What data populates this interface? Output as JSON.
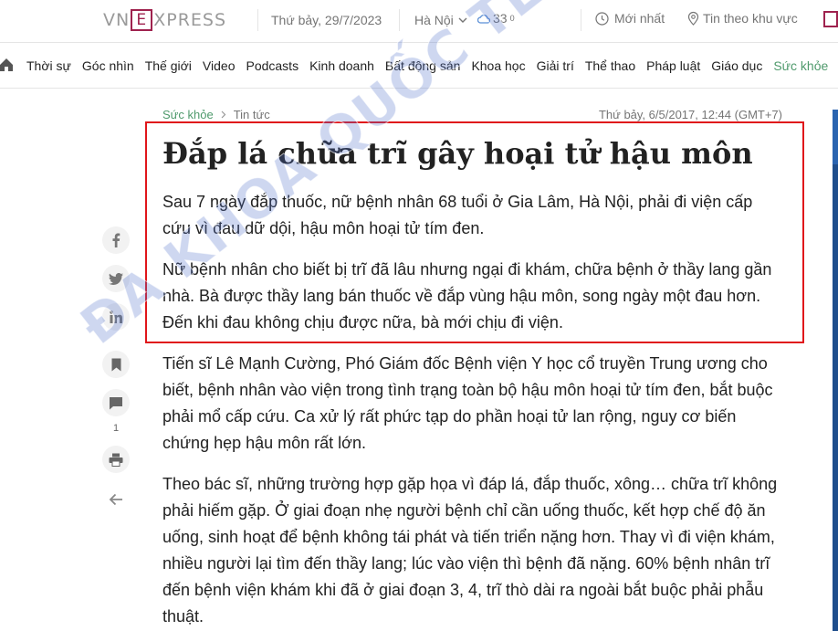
{
  "header": {
    "logo_left": "VN",
    "logo_mark": "E",
    "logo_right": "XPRESS",
    "date": "Thứ bảy, 29/7/2023",
    "location": "Hà Nội",
    "temperature": "33",
    "temperature_unit": "0",
    "newest_label": "Mới nhất",
    "regional_label": "Tin theo khu vực"
  },
  "nav": {
    "items": [
      "Thời sự",
      "Góc nhìn",
      "Thế giới",
      "Video",
      "Podcasts",
      "Kinh doanh",
      "Bất động sản",
      "Khoa học",
      "Giải trí",
      "Thể thao",
      "Pháp luật",
      "Giáo dục",
      "Sức khỏe"
    ],
    "active": "Sức khỏe"
  },
  "sidebar": {
    "comment_count": "1"
  },
  "article": {
    "breadcrumb": [
      "Sức khỏe",
      "Tin tức"
    ],
    "published": "Thứ bảy, 6/5/2017, 12:44 (GMT+7)",
    "title": "Đắp lá chữa trĩ gây hoại tử hậu môn",
    "lead": "Sau 7 ngày đắp thuốc, nữ bệnh nhân 68 tuổi ở Gia Lâm, Hà Nội, phải đi viện cấp cứu vì đau dữ dội, hậu môn hoại tử tím đen.",
    "paragraphs": [
      "Nữ bệnh nhân cho biết bị trĩ đã lâu nhưng ngại đi khám, chữa bệnh ở thầy lang gần nhà. Bà được thầy lang bán thuốc về đắp vùng hậu môn, song ngày một đau hơn. Đến khi đau không chịu được nữa, bà mới chịu đi viện.",
      "Tiến sĩ Lê Mạnh Cường, Phó Giám đốc Bệnh viện Y học cổ truyền Trung ương cho biết, bệnh nhân vào viện trong tình trạng toàn bộ hậu môn hoại tử tím đen, bắt buộc phải mổ cấp cứu. Ca xử lý rất phức tạp do phần hoại tử lan rộng, nguy cơ biến chứng hẹp hậu môn rất lớn.",
      "Theo bác sĩ, những trường hợp gặp họa vì đáp lá, đắp thuốc, xông… chữa trĩ không phải hiếm gặp. Ở giai đoạn nhẹ người bệnh chỉ cần uống thuốc, kết hợp chế độ ăn uống, sinh hoạt để bệnh không tái phát và tiến triển nặng hơn. Thay vì đi viện khám, nhiều người lại tìm đến thầy lang; lúc vào viện thì bệnh đã nặng. 60% bệnh nhân trĩ đến bệnh viện khám khi đã ở giai đoạn 3, 4, trĩ thò dài ra ngoài bắt buộc phải phẫu thuật."
    ]
  },
  "watermark": "ĐA KHOA QUỐC TẾ CỘNG ĐỒNG",
  "colors": {
    "brand": "#9f224e",
    "active_nav": "#4f9a6c",
    "highlight_box": "#e0161b"
  }
}
